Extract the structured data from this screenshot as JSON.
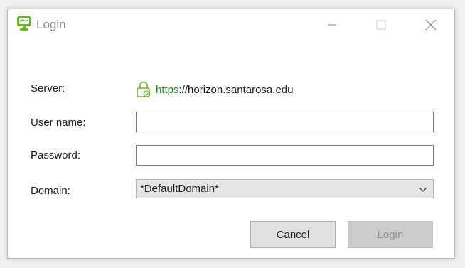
{
  "window": {
    "title": "Login",
    "controls": {
      "minimize_icon": "minimize-icon",
      "maximize_icon": "maximize-icon",
      "close_icon": "close-icon"
    }
  },
  "form": {
    "server": {
      "label": "Server:",
      "scheme": "https",
      "host": "://horizon.santarosa.edu",
      "icon": "lock-icon"
    },
    "username": {
      "label": "User name:",
      "value": "",
      "placeholder": ""
    },
    "password": {
      "label": "Password:",
      "value": "",
      "placeholder": ""
    },
    "domain": {
      "label": "Domain:",
      "selected": "*DefaultDomain*"
    }
  },
  "buttons": {
    "cancel": "Cancel",
    "login": "Login"
  },
  "colors": {
    "brand_green": "#6bb52d",
    "secure_scheme": "#1e8a1e",
    "disabled_text": "#8f8f8f"
  }
}
